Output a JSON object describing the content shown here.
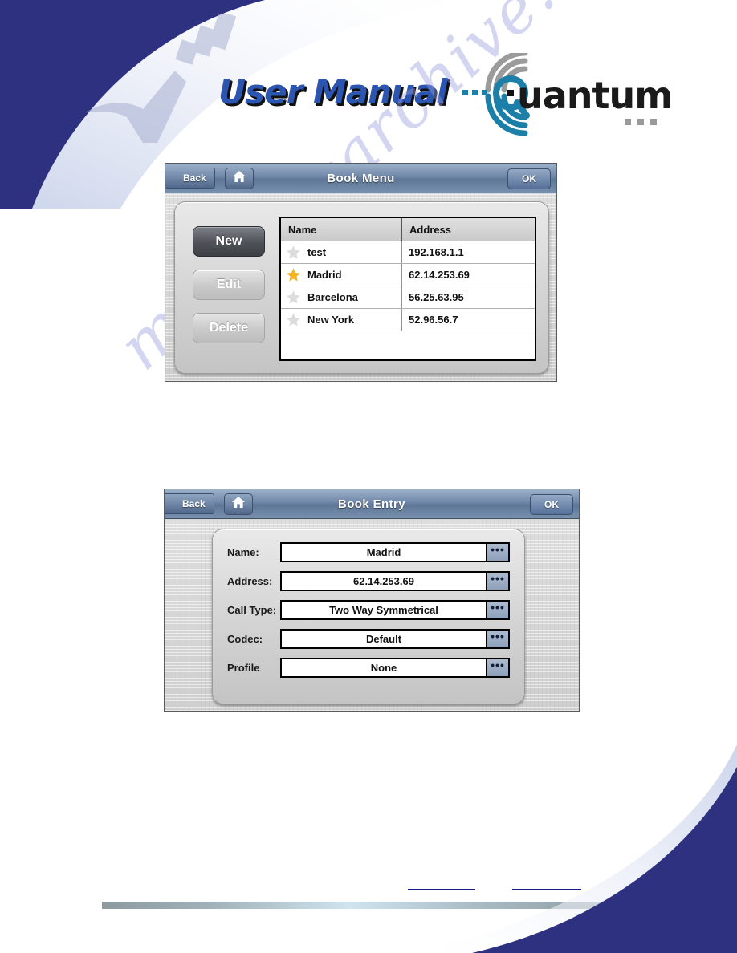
{
  "header": {
    "user_manual_text": "User Manual",
    "brand_word": "uantum",
    "brand_initial": "Q",
    "brand_name": "Quantum"
  },
  "watermark": {
    "text": "manualsarchive.com"
  },
  "panels": [
    {
      "id": "book-menu",
      "titlebar": {
        "back_label": "Back",
        "home_icon": "home-icon",
        "title": "Book Menu",
        "ok_label": "OK"
      },
      "side_buttons": [
        {
          "label": "New",
          "state": "active"
        },
        {
          "label": "Edit",
          "state": "idle"
        },
        {
          "label": "Delete",
          "state": "idle"
        }
      ],
      "table": {
        "columns": [
          "Name",
          "Address"
        ],
        "rows": [
          {
            "favorite": false,
            "name": "test",
            "address": "192.168.1.1"
          },
          {
            "favorite": true,
            "name": "Madrid",
            "address": "62.14.253.69"
          },
          {
            "favorite": false,
            "name": "Barcelona",
            "address": "56.25.63.95"
          },
          {
            "favorite": false,
            "name": "New York",
            "address": "52.96.56.7"
          }
        ]
      }
    },
    {
      "id": "book-entry",
      "titlebar": {
        "back_label": "Back",
        "home_icon": "home-icon",
        "title": "Book Entry",
        "ok_label": "OK"
      },
      "fields": [
        {
          "label": "Name:",
          "value": "Madrid"
        },
        {
          "label": "Address:",
          "value": "62.14.253.69"
        },
        {
          "label": "Call Type:",
          "value": "Two Way Symmetrical"
        },
        {
          "label": "Codec:",
          "value": "Default"
        },
        {
          "label": "Profile",
          "value": "None"
        }
      ],
      "ellipsis": "•••"
    }
  ],
  "colors": {
    "navy": "#2e3180",
    "titlebar_blue": "#6f87a8",
    "star_on": "#f5b521",
    "star_off": "#dcdcdc",
    "brand_teal": "#1b7fa8",
    "brand_gray": "#9b9b9b",
    "rule_blue": "#1a1a8c"
  }
}
